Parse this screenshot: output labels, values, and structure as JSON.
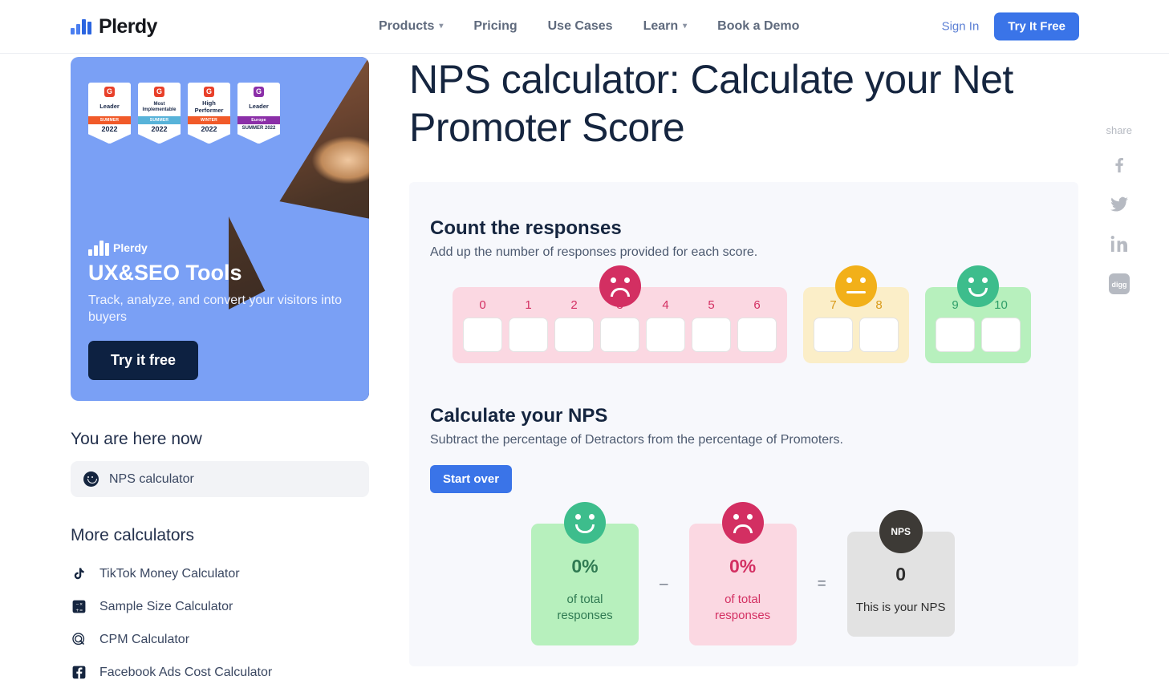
{
  "header": {
    "logo_text": "Plerdy",
    "flag": "ukraine-flag",
    "nav": [
      {
        "label": "Products",
        "has_caret": true
      },
      {
        "label": "Pricing",
        "has_caret": false
      },
      {
        "label": "Use Cases",
        "has_caret": false
      },
      {
        "label": "Learn",
        "has_caret": true
      },
      {
        "label": "Book a Demo",
        "has_caret": false
      }
    ],
    "sign_in": "Sign In",
    "try_free": "Try It Free"
  },
  "promo": {
    "badges": [
      {
        "title": "Leader",
        "band": "SUMMER",
        "band_color": "#f15a29",
        "g2_color": "#e8402a",
        "year": "2022",
        "small_title": false
      },
      {
        "title": "Most Implementable",
        "band": "SUMMER",
        "band_color": "#58b3d9",
        "g2_color": "#e8402a",
        "year": "2022",
        "small_title": true
      },
      {
        "title": "High Performer",
        "band": "WINTER",
        "band_color": "#f15a29",
        "g2_color": "#e8402a",
        "year": "2022",
        "small_title": false
      },
      {
        "title": "Leader",
        "band": "Europe",
        "band_color": "#8b2fa8",
        "g2_color": "#8b2fa8",
        "year": "SUMMER 2022",
        "small_title": false
      }
    ],
    "brand": "Plerdy",
    "headline": "UX&SEO Tools",
    "text": "Track, analyze, and convert your visitors into buyers",
    "button": "Try it free"
  },
  "sidebar": {
    "here_heading": "You are here now",
    "here_item": {
      "label": "NPS calculator",
      "icon": "smiley-icon"
    },
    "more_heading": "More calculators",
    "more_items": [
      {
        "label": "TikTok Money Calculator",
        "icon": "tiktok-icon"
      },
      {
        "label": "Sample Size Calculator",
        "icon": "calculator-icon"
      },
      {
        "label": "CPM Calculator",
        "icon": "cpm-icon"
      },
      {
        "label": "Facebook Ads Cost Calculator",
        "icon": "facebook-icon"
      }
    ]
  },
  "main": {
    "title": "NPS calculator: Calculate your Net Promoter Score",
    "count_section": {
      "heading": "Count the responses",
      "description": "Add up the number of responses provided for each score.",
      "groups": [
        {
          "name": "detractors",
          "face": "sad-face-icon",
          "bg_color": "#fbd8e2",
          "label_color": "#d32f62",
          "scores": [
            {
              "label": "0",
              "value": ""
            },
            {
              "label": "1",
              "value": ""
            },
            {
              "label": "2",
              "value": ""
            },
            {
              "label": "3",
              "value": ""
            },
            {
              "label": "4",
              "value": ""
            },
            {
              "label": "5",
              "value": ""
            },
            {
              "label": "6",
              "value": ""
            }
          ]
        },
        {
          "name": "passives",
          "face": "neutral-face-icon",
          "bg_color": "#fbeec8",
          "label_color": "#d99a18",
          "scores": [
            {
              "label": "7",
              "value": ""
            },
            {
              "label": "8",
              "value": ""
            }
          ]
        },
        {
          "name": "promoters",
          "face": "happy-face-icon",
          "bg_color": "#b7f0bd",
          "label_color": "#2f9e69",
          "scores": [
            {
              "label": "9",
              "value": ""
            },
            {
              "label": "10",
              "value": ""
            }
          ]
        }
      ]
    },
    "calc_section": {
      "heading": "Calculate your NPS",
      "description": "Subtract the percentage of Detractors from the percentage of Promoters.",
      "start_over": "Start over",
      "promoters_card": {
        "value": "0%",
        "sub": "of total responses",
        "face": "happy-face-icon"
      },
      "operator_minus": "–",
      "detractors_card": {
        "value": "0%",
        "sub": "of total responses",
        "face": "sad-face-icon"
      },
      "operator_equals": "=",
      "nps_card": {
        "badge": "NPS",
        "value": "0",
        "sub": "This is your NPS"
      }
    }
  },
  "share": {
    "label": "share",
    "items": [
      {
        "name": "facebook-icon"
      },
      {
        "name": "twitter-icon"
      },
      {
        "name": "linkedin-icon"
      },
      {
        "name": "digg-icon"
      }
    ]
  },
  "colors": {
    "brand_blue": "#3a74e8",
    "navy": "#15253f",
    "detractor": "#d32f62",
    "passive": "#f2b019",
    "promoter": "#3dbd8c"
  }
}
